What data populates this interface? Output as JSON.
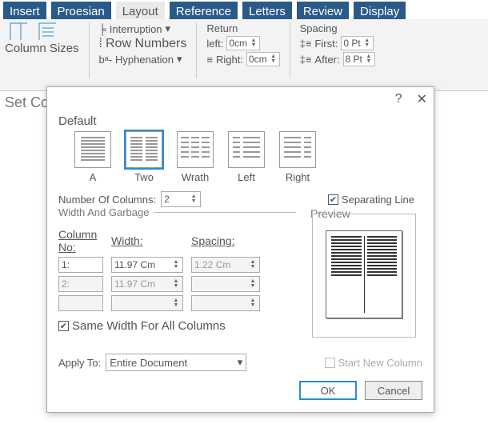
{
  "tabs": {
    "insert": "Insert",
    "design": "Proesian",
    "layout": "Layout",
    "reference": "Reference",
    "letters": "Letters",
    "review": "Review",
    "display": "Display"
  },
  "ribbon": {
    "columnSizes": "Column Sizes",
    "interruption": "Interruption",
    "rowNumbers": "Row Numbers",
    "hyphenation": "Hyphenation",
    "return": "Return",
    "left": "left:",
    "leftVal": "0cm",
    "right": "Right:",
    "rightVal": "0cm",
    "spacing": "Spacing",
    "first": "First:",
    "firstVal": "0 Pt",
    "after": "After:",
    "afterVal": "8 Pt"
  },
  "dialog": {
    "windowTitle": "Set Columns",
    "help": "?",
    "default": "Default",
    "presets": {
      "a": "A",
      "two": "Two",
      "wrath": "Wrath",
      "left": "Left",
      "right": "Right"
    },
    "numCols": "Number Of Columns:",
    "numColsVal": "2",
    "sepLine": "Separating Line",
    "widthGarbage": "Width And Garbage",
    "colNo": "Column No:",
    "width": "Width:",
    "spacingHdr": "Spacing:",
    "rows": [
      {
        "n": "1:",
        "w": "11.97 Cm",
        "s": "1.22 Cm"
      },
      {
        "n": "2:",
        "w": "11.97 Cm",
        "s": ""
      },
      {
        "n": "",
        "w": "",
        "s": ""
      }
    ],
    "sameWidth": "Same Width For All Columns",
    "preview": "Preview",
    "startNew": "Start New Column",
    "applyTo": "Apply To:",
    "applyToVal": "Entire Document",
    "ok": "OK",
    "cancel": "Cancel"
  }
}
